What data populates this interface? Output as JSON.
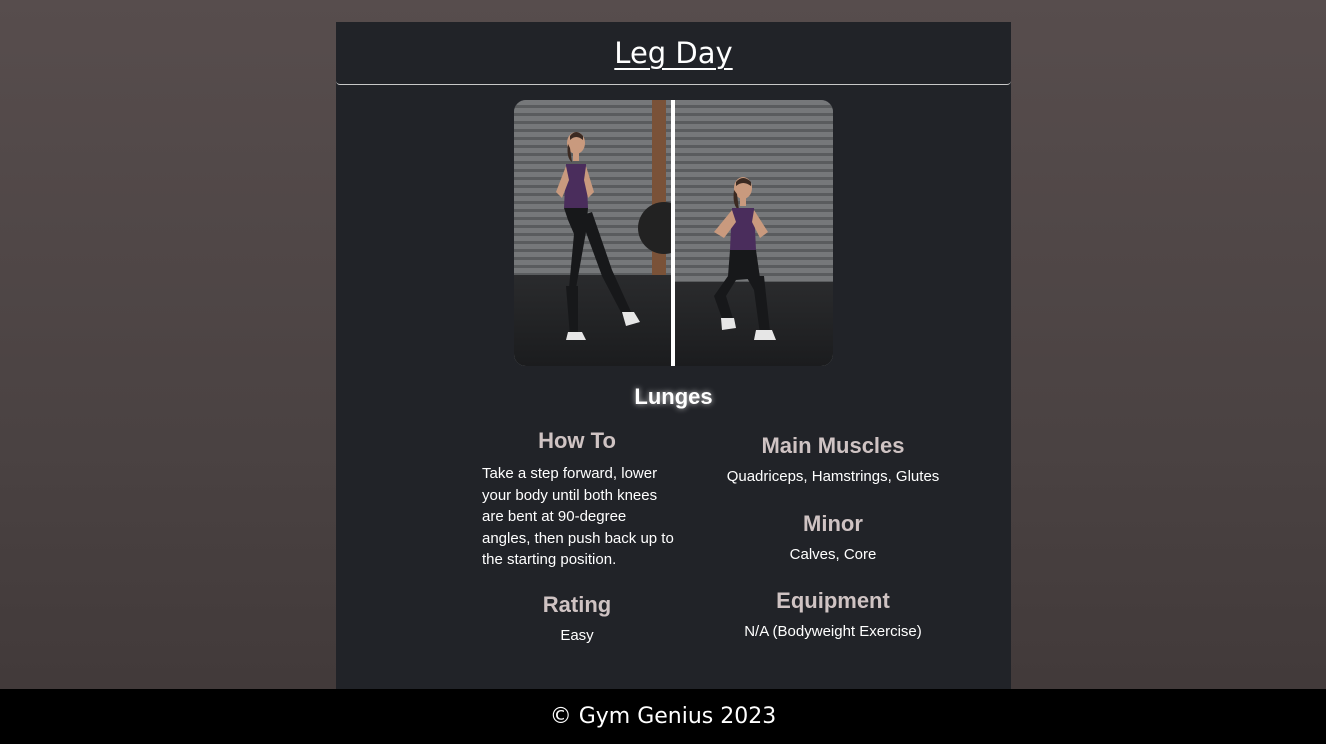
{
  "header": {
    "title": "Leg Day"
  },
  "exercise": {
    "name": "Lunges",
    "image_alt": "Woman demonstrating a lunge in two steps",
    "how_to": {
      "heading": "How To",
      "text": "Take a step forward, lower your body until both knees are bent at 90-degree angles, then push back up to the starting position."
    },
    "rating": {
      "heading": "Rating",
      "value": "Easy"
    },
    "main_muscles": {
      "heading": "Main Muscles",
      "value": "Quadriceps, Hamstrings, Glutes"
    },
    "minor": {
      "heading": "Minor",
      "value": "Calves, Core"
    },
    "equipment": {
      "heading": "Equipment",
      "value": "N/A (Bodyweight Exercise)"
    }
  },
  "footer": {
    "text": "© Gym Genius 2023"
  },
  "colors": {
    "panel_bg": "#212328",
    "heading_color": "#cfc3c3",
    "shirt_purple": "#4a2d5c"
  }
}
